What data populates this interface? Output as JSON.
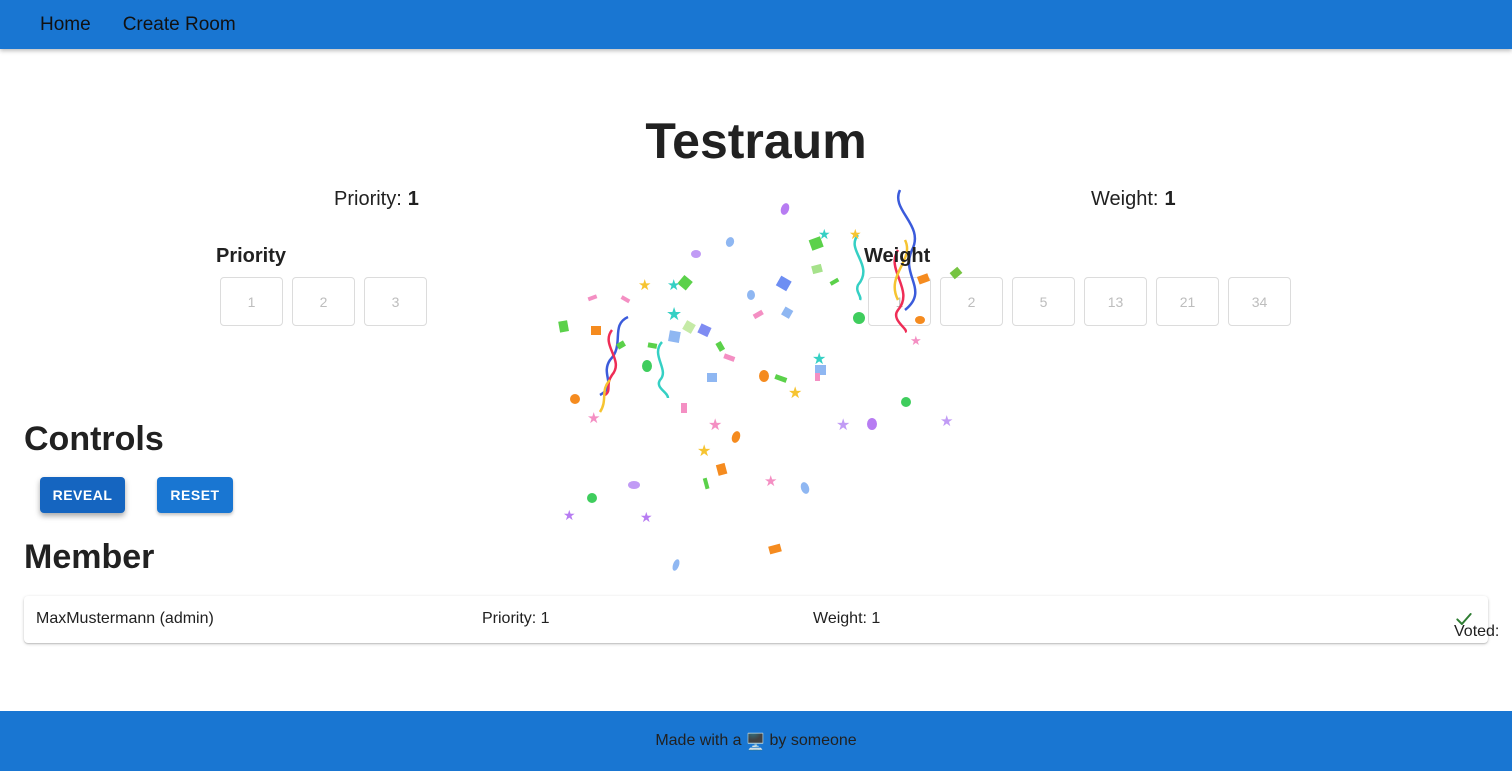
{
  "nav": {
    "home_label": "Home",
    "create_room_label": "Create Room"
  },
  "room": {
    "title": "Testraum"
  },
  "results": {
    "priority_label": "Priority:",
    "priority_value": "1",
    "weight_label": "Weight:",
    "weight_value": "1"
  },
  "priority": {
    "heading": "Priority",
    "cards": [
      "1",
      "2",
      "3"
    ]
  },
  "weight": {
    "heading": "Weight",
    "cards": [
      "1",
      "2",
      "5",
      "13",
      "21",
      "34"
    ]
  },
  "controls": {
    "heading": "Controls",
    "reveal_label": "REVEAL",
    "reset_label": "RESET"
  },
  "members": {
    "heading": "Member",
    "rows": [
      {
        "name": "MaxMustermann (admin)",
        "priority": "Priority: 1",
        "weight": "Weight: 1",
        "voted_label": "Voted:",
        "voted_icon": "check-icon"
      }
    ]
  },
  "footer": {
    "text_before": "Made with a",
    "icon": "monitor-icon",
    "text_after": "by someone"
  },
  "colors": {
    "primary": "#1976d2",
    "primary_dark": "#1565c0",
    "check": "#2e7d32"
  }
}
